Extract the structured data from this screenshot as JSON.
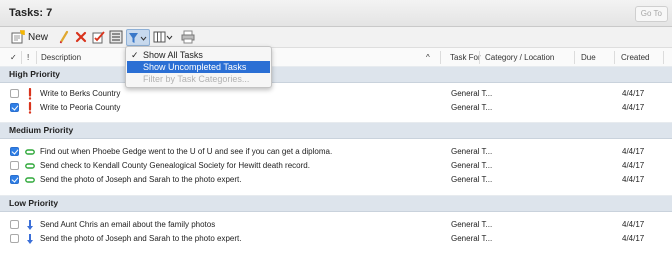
{
  "window": {
    "title": "Tasks: 7",
    "goto_label": "Go To"
  },
  "toolbar": {
    "new_label": "New",
    "buttons": [
      "new-task-icon",
      "edit-pencil-icon",
      "delete-icon",
      "mark-complete-icon",
      "report-icon",
      "filter-icon",
      "columns-icon",
      "print-icon"
    ]
  },
  "columns": {
    "check": "✓",
    "priority": "!",
    "description": "Description",
    "sort_indicator": "^",
    "task_for": "Task For",
    "category": "Category / Location",
    "due": "Due",
    "created": "Created"
  },
  "filter_menu": {
    "items": [
      {
        "check": "✓",
        "label": "Show All Tasks",
        "state": "checked"
      },
      {
        "check": "",
        "label": "Show Uncompleted Tasks",
        "state": "highlighted"
      },
      {
        "check": "",
        "label": "Filter by Task Categories...",
        "state": "disabled"
      }
    ]
  },
  "groups": [
    {
      "label": "High Priority",
      "rows": [
        {
          "checked": false,
          "priority": "high",
          "description": "Write to Berks Country",
          "task_for": "General T...",
          "created": "4/4/17"
        },
        {
          "checked": true,
          "priority": "high",
          "description": "Write to Peoria County",
          "task_for": "General T...",
          "created": "4/4/17"
        }
      ]
    },
    {
      "label": "Medium Priority",
      "rows": [
        {
          "checked": true,
          "priority": "medium",
          "description": "Find out when Phoebe Gedge went to the U of U and see if you can get a diploma.",
          "task_for": "General T...",
          "created": "4/4/17"
        },
        {
          "checked": false,
          "priority": "medium",
          "description": "Send check to Kendall County Genealogical Society for Hewitt death record.",
          "task_for": "General T...",
          "created": "4/4/17"
        },
        {
          "checked": true,
          "priority": "medium",
          "description": "Send the photo of Joseph and Sarah to the photo expert.",
          "task_for": "General T...",
          "created": "4/4/17"
        }
      ]
    },
    {
      "label": "Low Priority",
      "rows": [
        {
          "checked": false,
          "priority": "low",
          "description": "Send Aunt Chris an email about the family photos",
          "task_for": "General T...",
          "created": "4/4/17"
        },
        {
          "checked": false,
          "priority": "low",
          "description": "Send the photo of Joseph and Sarah to the photo expert.",
          "task_for": "General T...",
          "created": "4/4/17"
        }
      ]
    }
  ],
  "colors": {
    "high": "#d9331c",
    "medium": "#2fa83a",
    "low": "#3b6fd8",
    "check_on": "#2f7fe6",
    "menu_highlight": "#2b6fd4",
    "group_band": "#dde4ec"
  }
}
